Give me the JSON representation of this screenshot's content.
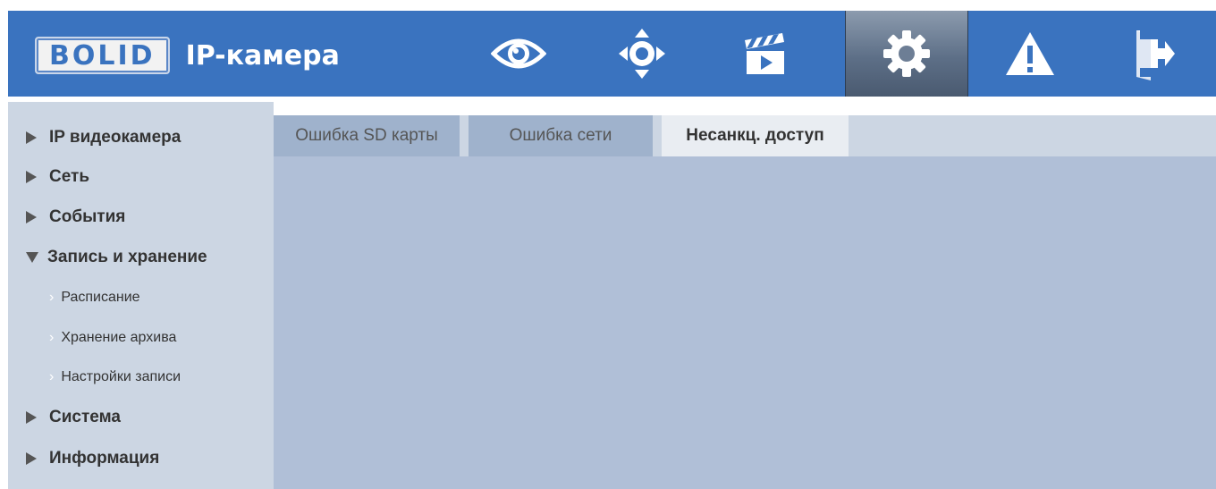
{
  "header": {
    "logo_brand": "BOLID",
    "logo_product": "IP-камера",
    "nav": [
      {
        "icon": "eye-icon",
        "active": false
      },
      {
        "icon": "ptz-icon",
        "active": false
      },
      {
        "icon": "clapperboard-icon",
        "active": false
      },
      {
        "icon": "gear-icon",
        "active": true
      },
      {
        "icon": "warning-icon",
        "active": false
      },
      {
        "icon": "logout-icon",
        "active": false
      }
    ]
  },
  "sidebar": {
    "items": [
      {
        "label": "IP видеокамера",
        "type": "main",
        "expanded": false
      },
      {
        "label": "Сеть",
        "type": "main",
        "expanded": false
      },
      {
        "label": "События",
        "type": "main",
        "expanded": false
      },
      {
        "label": "Запись и хранение",
        "type": "main",
        "expanded": true
      },
      {
        "label": "Расписание",
        "type": "sub"
      },
      {
        "label": "Хранение архива",
        "type": "sub"
      },
      {
        "label": "Настройки записи",
        "type": "sub"
      },
      {
        "label": "Система",
        "type": "main",
        "expanded": false
      },
      {
        "label": "Информация",
        "type": "main",
        "expanded": false
      }
    ]
  },
  "tabs": [
    {
      "label": "Ошибка SD карты",
      "active": false
    },
    {
      "label": "Ошибка сети",
      "active": false
    },
    {
      "label": "Несанкц. доступ",
      "active": true
    }
  ],
  "colors": {
    "header_bg": "#3a73bf",
    "sidebar_bg": "#ccd6e3",
    "content_bg": "#b0bfd7",
    "tab_bg": "#9fb2cc",
    "tab_active_bg": "#e9edf2"
  }
}
